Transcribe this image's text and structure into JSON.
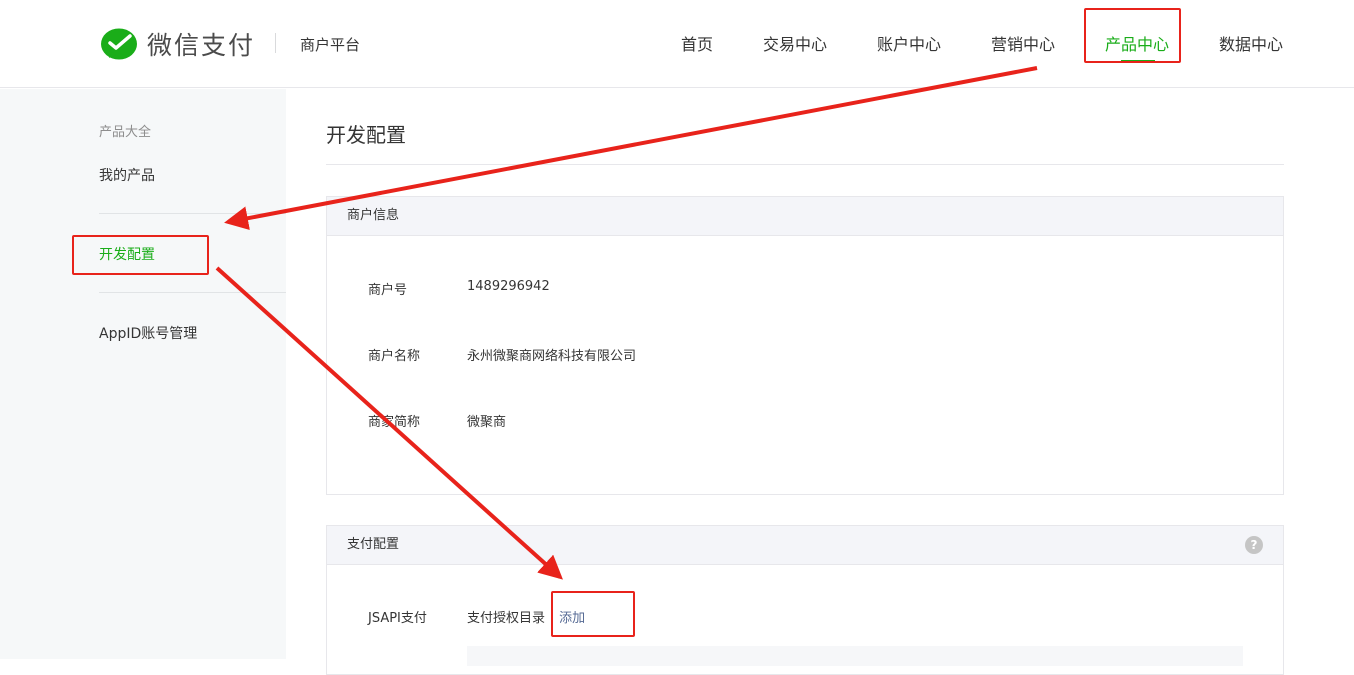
{
  "header": {
    "brand": "微信支付",
    "platform": "商户平台",
    "nav": [
      {
        "label": "首页"
      },
      {
        "label": "交易中心"
      },
      {
        "label": "账户中心"
      },
      {
        "label": "营销中心"
      },
      {
        "label": "产品中心",
        "active": true
      },
      {
        "label": "数据中心"
      }
    ]
  },
  "sidebar": {
    "group_label": "产品大全",
    "items": [
      {
        "label": "我的产品"
      },
      {
        "label": "开发配置",
        "active": true
      },
      {
        "label": "AppID账号管理"
      }
    ]
  },
  "main": {
    "title": "开发配置",
    "merchant_info": {
      "heading": "商户信息",
      "rows": [
        {
          "label": "商户号",
          "value": "1489296942"
        },
        {
          "label": "商户名称",
          "value": "永州微聚商网络科技有限公司"
        },
        {
          "label": "商家简称",
          "value": "微聚商"
        }
      ]
    },
    "pay_config": {
      "heading": "支付配置",
      "help_icon": "?",
      "jsapi_label": "JSAPI支付",
      "auth_dir_label": "支付授权目录",
      "add_label": "添加"
    }
  },
  "colors": {
    "accent_green": "#1aad19",
    "annotation_red": "#e8231b",
    "link_blue": "#576b95"
  },
  "icons": {
    "logo": "wechat-pay-check-icon",
    "help": "question-circle-icon"
  }
}
